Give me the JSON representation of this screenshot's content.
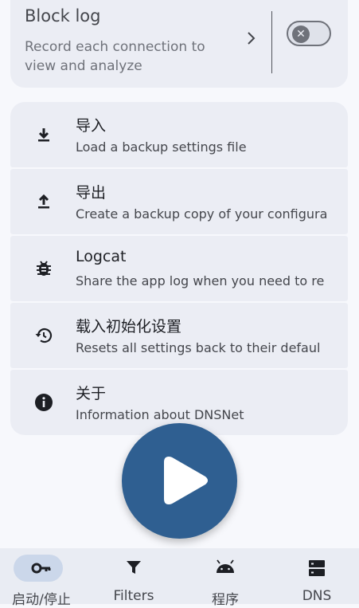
{
  "block_log": {
    "title": "Block log",
    "subtitle": "Record each connection to view and analyze",
    "toggle_on": false
  },
  "settings": [
    {
      "title": "导入",
      "subtitle": "Load a backup settings file",
      "icon": "download-icon"
    },
    {
      "title": "导出",
      "subtitle": "Create a backup copy of your configura",
      "icon": "upload-icon"
    },
    {
      "title": "Logcat",
      "subtitle": "Share the app log when you need to re",
      "icon": "bug-icon"
    },
    {
      "title": "载入初始化设置",
      "subtitle": "Resets all settings back to their defaul",
      "icon": "restore-icon"
    },
    {
      "title": "关于",
      "subtitle": "Information about DNSNet",
      "icon": "info-icon"
    }
  ],
  "fab": {
    "icon": "play-icon",
    "color": "#2f5f91"
  },
  "nav": [
    {
      "label": "启动/停止",
      "icon": "key-icon",
      "selected": true
    },
    {
      "label": "Filters",
      "icon": "filter-icon",
      "selected": false
    },
    {
      "label": "程序",
      "icon": "android-icon",
      "selected": false
    },
    {
      "label": "DNS",
      "icon": "dns-icon",
      "selected": false
    }
  ],
  "colors": {
    "background": "#f7f8fc",
    "card": "#ebedf4",
    "accent": "#2f5f91",
    "nav_pill": "#cbd7ea"
  }
}
